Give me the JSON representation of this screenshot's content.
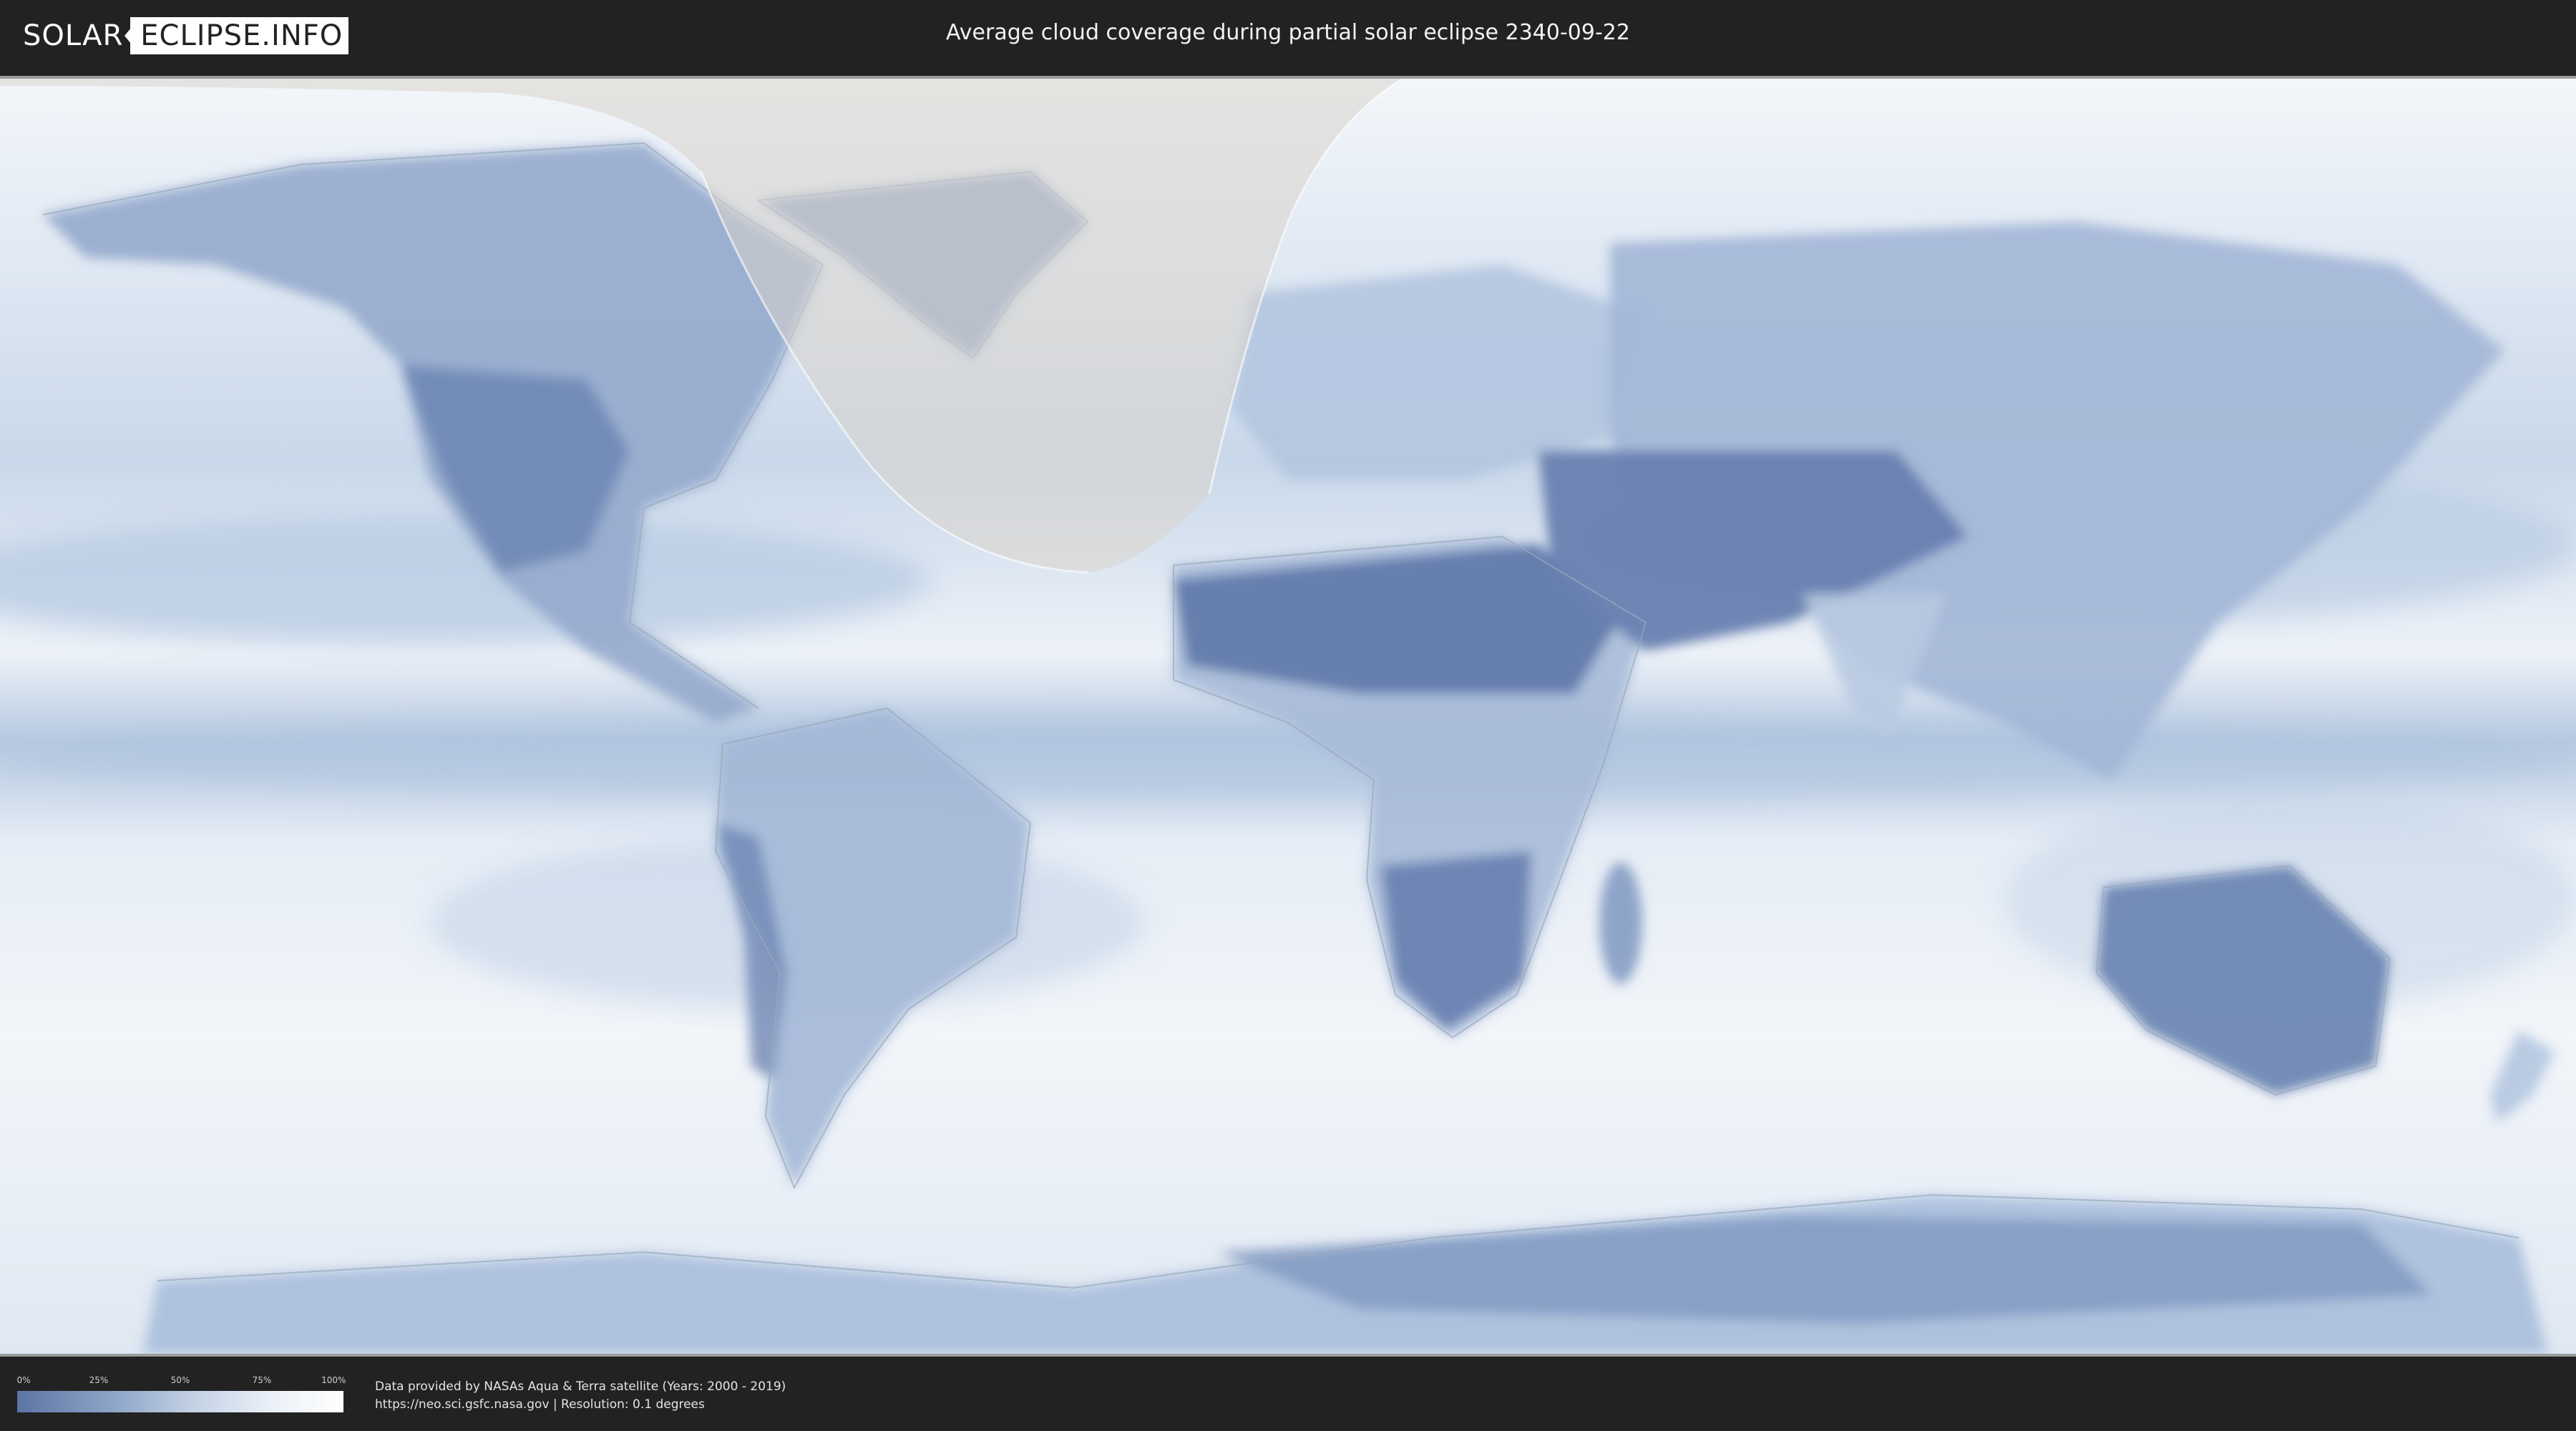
{
  "header": {
    "logo_left": "SOLAR",
    "logo_right": "ECLIPSE.INFO",
    "title": "Average cloud coverage during partial solar eclipse 2340-09-22"
  },
  "legend": {
    "ticks": [
      "0%",
      "25%",
      "50%",
      "75%",
      "100%"
    ],
    "colors": {
      "clear": "#5c74a3",
      "cloudy": "#ffffff"
    }
  },
  "credits": {
    "line1": "Data provided by NASAs Aqua & Terra satellite (Years: 2000 - 2019)",
    "line2": "https://neo.sci.gsfc.nasa.gov | Resolution: 0.1 degrees"
  },
  "map": {
    "colors": {
      "ocean": "#e9f0f8",
      "cloud_band": "#a9c0dd",
      "dry_land": "#6f87b4",
      "eclipse_overlay": "#d9d4cc"
    }
  }
}
